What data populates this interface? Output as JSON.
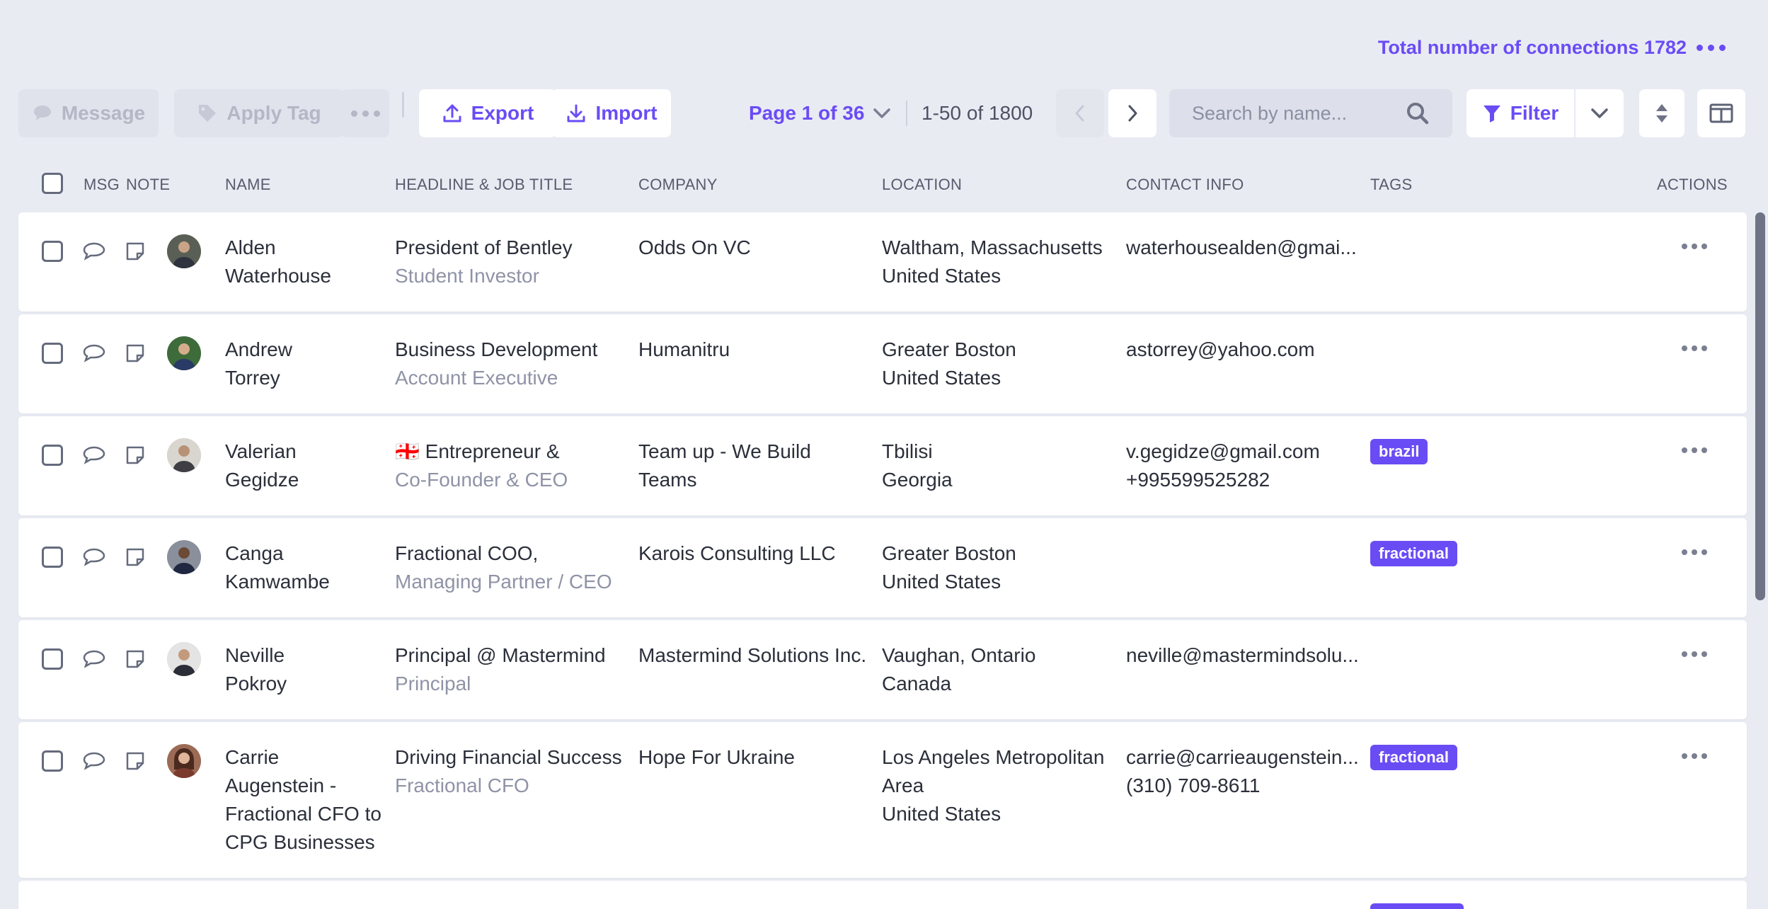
{
  "header": {
    "total_label": "Total number of connections 1782"
  },
  "toolbar": {
    "message_label": "Message",
    "apply_tag_label": "Apply Tag",
    "export_label": "Export",
    "import_label": "Import",
    "page_label": "Page 1 of 36",
    "range_label": "1-50 of 1800",
    "search_placeholder": "Search by name...",
    "filter_label": "Filter"
  },
  "columns": {
    "msg": "MSG",
    "note": "NOTE",
    "name": "NAME",
    "headline": "HEADLINE & JOB TITLE",
    "company": "COMPANY",
    "location": "LOCATION",
    "contact": "CONTACT INFO",
    "tags": "TAGS",
    "actions": "ACTIONS"
  },
  "colors": {
    "accent": "#6a4cf5",
    "background": "#e9ebf3",
    "row": "#ffffff",
    "muted_text": "#8f93a6"
  },
  "rows": [
    {
      "name_line1": "Alden",
      "name_line2": "Waterhouse",
      "headline": "President of Bentley",
      "job_title": "Student Investor",
      "company": "Odds On VC",
      "location_line1": "Waltham, Massachusetts",
      "location_line2": "United States",
      "contact_line1": "waterhousealden@gmai...",
      "contact_line2": "",
      "tag": ""
    },
    {
      "name_line1": "Andrew",
      "name_line2": "Torrey",
      "headline": "Business Development",
      "job_title": "Account Executive",
      "company": "Humanitru",
      "location_line1": "Greater Boston",
      "location_line2": "United States",
      "contact_line1": "astorrey@yahoo.com",
      "contact_line2": "",
      "tag": ""
    },
    {
      "name_line1": "Valerian",
      "name_line2": "Gegidze",
      "headline": "🇬🇪 Entrepreneur &",
      "job_title": "Co-Founder & CEO",
      "company_line1": "Team up - We Build",
      "company_line2": "Teams",
      "location_line1": "Tbilisi",
      "location_line2": "Georgia",
      "contact_line1": "v.gegidze@gmail.com",
      "contact_line2": "+995599525282",
      "tag": "brazil"
    },
    {
      "name_line1": "Canga",
      "name_line2": "Kamwambe",
      "headline": "Fractional COO,",
      "job_title": "Managing Partner / CEO",
      "company": "Karois Consulting LLC",
      "location_line1": "Greater Boston",
      "location_line2": "United States",
      "contact_line1": "",
      "contact_line2": "",
      "tag": "fractional"
    },
    {
      "name_line1": "Neville",
      "name_line2": "Pokroy",
      "headline": "Principal @ Mastermind",
      "job_title": "Principal",
      "company": "Mastermind Solutions Inc.",
      "location_line1": "Vaughan, Ontario",
      "location_line2": "Canada",
      "contact_line1": "neville@mastermindsolu...",
      "contact_line2": "",
      "tag": ""
    },
    {
      "name_line1": "Carrie",
      "name_line2": "Augenstein -",
      "name_line3": "Fractional CFO to",
      "name_line4": "CPG Businesses",
      "headline": "Driving Financial Success",
      "job_title": "Fractional CFO",
      "company": "Hope For Ukraine",
      "location_line1": "Los Angeles Metropolitan",
      "location_line2": "Area",
      "location_line3": "United States",
      "contact_line1": "carrie@carrieaugenstein...",
      "contact_line2": "(310) 709-8611",
      "tag": "fractional"
    }
  ]
}
